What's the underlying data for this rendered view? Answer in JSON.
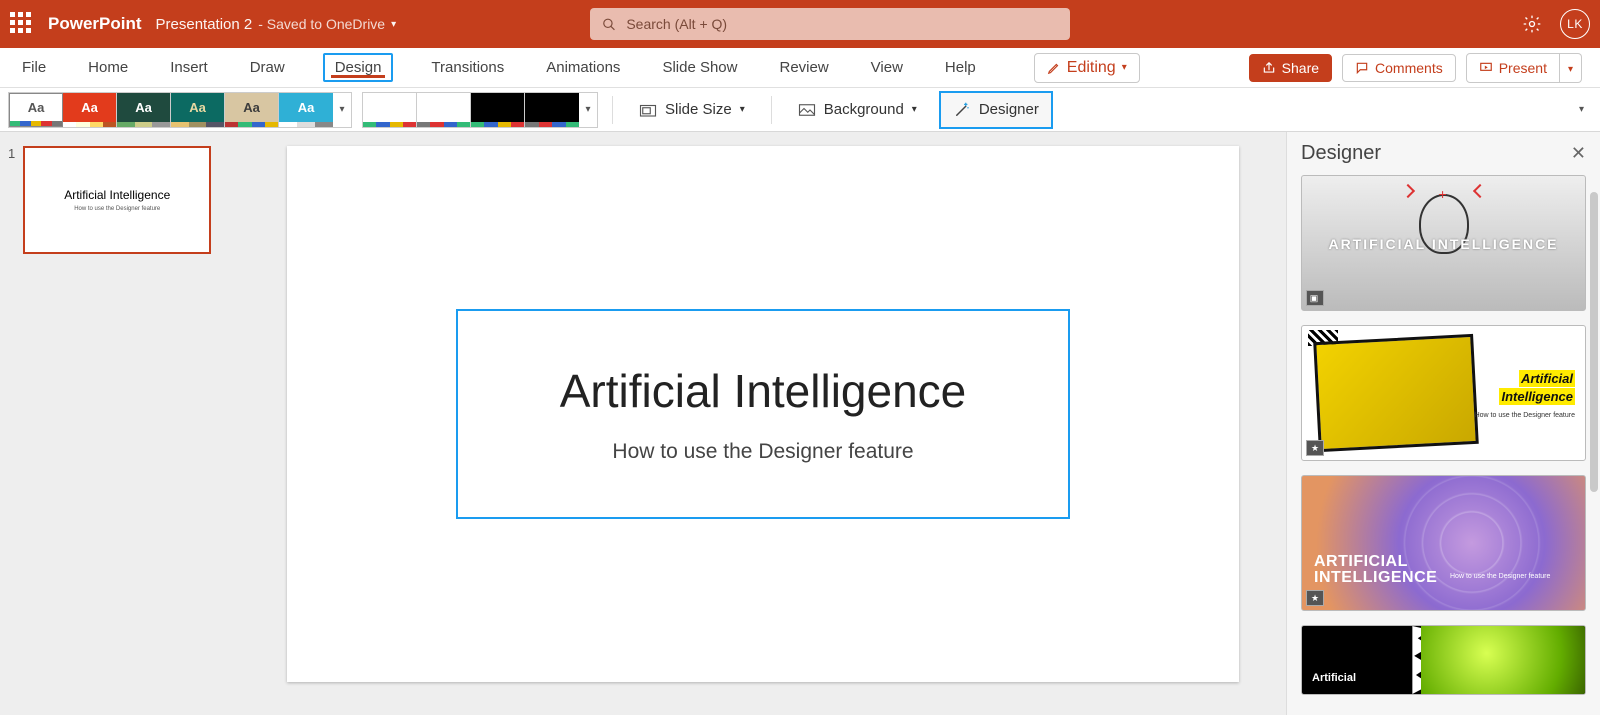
{
  "titlebar": {
    "app_name": "PowerPoint",
    "doc_name": "Presentation 2",
    "save_location": "- Saved to OneDrive",
    "search_placeholder": "Search (Alt + Q)",
    "avatar_initials": "LK"
  },
  "tabs": {
    "file": "File",
    "home": "Home",
    "insert": "Insert",
    "draw": "Draw",
    "design": "Design",
    "transitions": "Transitions",
    "animations": "Animations",
    "slideshow": "Slide Show",
    "review": "Review",
    "view": "View",
    "help": "Help"
  },
  "mode": {
    "label": "Editing"
  },
  "actions": {
    "share": "Share",
    "comments": "Comments",
    "present": "Present"
  },
  "ribbon": {
    "slide_size": "Slide Size",
    "background": "Background",
    "designer": "Designer",
    "themes": [
      {
        "label": "Aa",
        "bg": "#ffffff",
        "fg": "#555555"
      },
      {
        "label": "Aa",
        "bg": "#e23b1c",
        "fg": "#ffffff"
      },
      {
        "label": "Aa",
        "bg": "#1f4a3e",
        "fg": "#ffffff"
      },
      {
        "label": "Aa",
        "bg": "#0c6a62",
        "fg": "#e9d9a2"
      },
      {
        "label": "Aa",
        "bg": "#d8c6a2",
        "fg": "#3c3c3c"
      },
      {
        "label": "Aa",
        "bg": "#2fb0d6",
        "fg": "#ffffff"
      }
    ],
    "variants": [
      {
        "bg": "#ffffff"
      },
      {
        "bg": "#ffffff"
      },
      {
        "bg": "#000000"
      },
      {
        "bg": "#000000"
      }
    ]
  },
  "thumbnails": {
    "slide1_number": "1",
    "slide1_title": "Artificial Intelligence",
    "slide1_subtitle": "How to use the Designer feature"
  },
  "slide": {
    "title": "Artificial Intelligence",
    "subtitle": "How to use the Designer feature"
  },
  "designer_pane": {
    "title": "Designer",
    "suggestion1_text": "ARTIFICIAL INTELLIGENCE",
    "suggestion2_line1": "Artificial",
    "suggestion2_line2": "Intelligence",
    "suggestion2_sub": "How to use the Designer feature",
    "suggestion3_line1": "ARTIFICIAL",
    "suggestion3_line2": "INTELLIGENCE",
    "suggestion3_sub": "How to use the Designer feature",
    "suggestion4_text": "Artificial"
  }
}
